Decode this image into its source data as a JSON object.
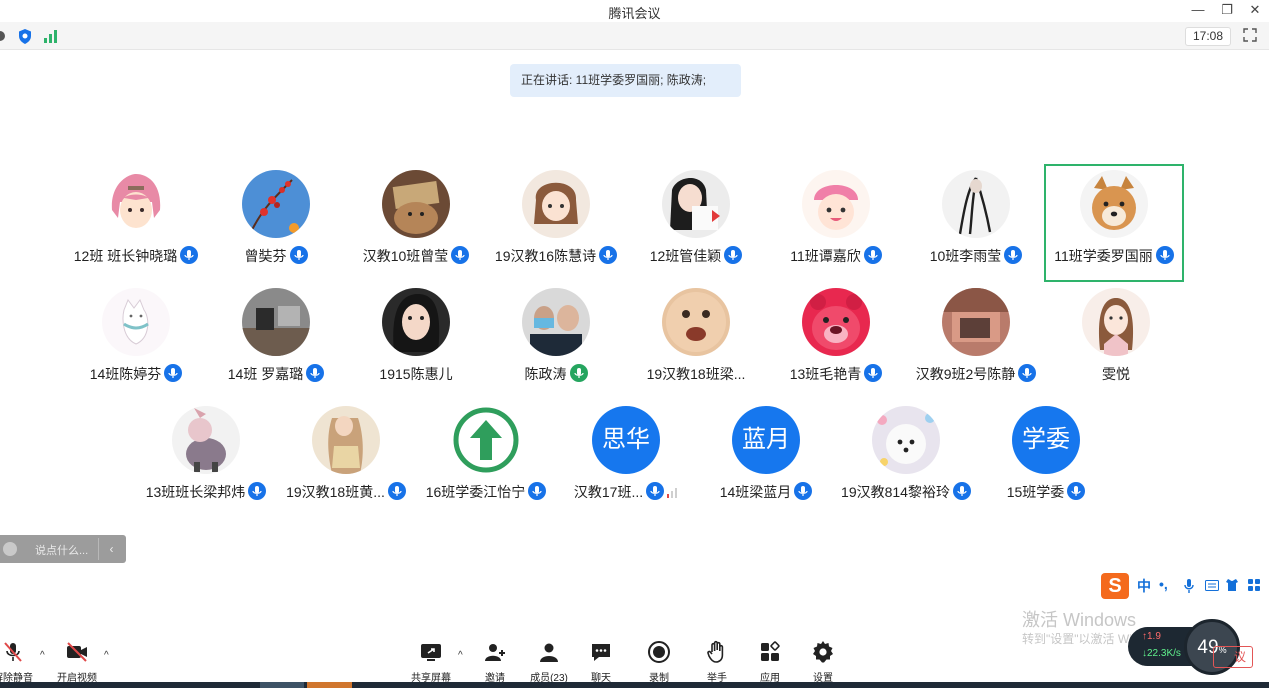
{
  "window": {
    "title": "腾讯会议"
  },
  "toolbar": {
    "clock": "17:08"
  },
  "speaking_banner": "正在讲话: 11班学委罗国丽; 陈政涛;",
  "participants": [
    {
      "name": "12班 班长钟晓璐"
    },
    {
      "name": "曾奘芬"
    },
    {
      "name": "汉教10班曾莹"
    },
    {
      "name": "19汉教16陈慧诗"
    },
    {
      "name": "12班管佳颖"
    },
    {
      "name": "11班谭嘉欣"
    },
    {
      "name": "10班李雨莹"
    },
    {
      "name": "11班学委罗国丽"
    },
    {
      "name": "14班陈婷芬"
    },
    {
      "name": "14班 罗嘉璐"
    },
    {
      "name": "1915陈惠儿"
    },
    {
      "name": "陈政涛"
    },
    {
      "name": "19汉教18班梁..."
    },
    {
      "name": "13班毛艳青"
    },
    {
      "name": "汉教9班2号陈静"
    },
    {
      "name": "雯悦"
    },
    {
      "name": "13班班长梁邦炜"
    },
    {
      "name": "19汉教18班黄..."
    },
    {
      "name": "16班学委江怡宁"
    },
    {
      "name": "汉教17班...",
      "avatar_text": "思华"
    },
    {
      "name": "14班梁蓝月",
      "avatar_text": "蓝月"
    },
    {
      "name": "19汉教814黎裕玲"
    },
    {
      "name": "15班学委",
      "avatar_text": "学委"
    }
  ],
  "chat": {
    "placeholder": "说点什么..."
  },
  "ime": {
    "zh": "中",
    "punct": "•,"
  },
  "watermark": {
    "line1": "激活 Windows",
    "line2": "转到\"设置\"以激活 Windows"
  },
  "network": {
    "up": "1.9",
    "down": "22.3",
    "unit": "K/s",
    "cpu": "49",
    "cpu_unit": "%"
  },
  "bottom": {
    "mute": "解除静音",
    "video": "开启视频",
    "share": "共享屏幕",
    "invite": "邀请",
    "members": "成员(23)",
    "chat": "聊天",
    "record": "录制",
    "raise_hand": "举手",
    "apps": "应用",
    "settings": "设置",
    "leave": "议"
  },
  "colors": {
    "mic_blue": "#1772e8",
    "active_border": "#2eb36b",
    "text_avatar": "#1677ee"
  }
}
